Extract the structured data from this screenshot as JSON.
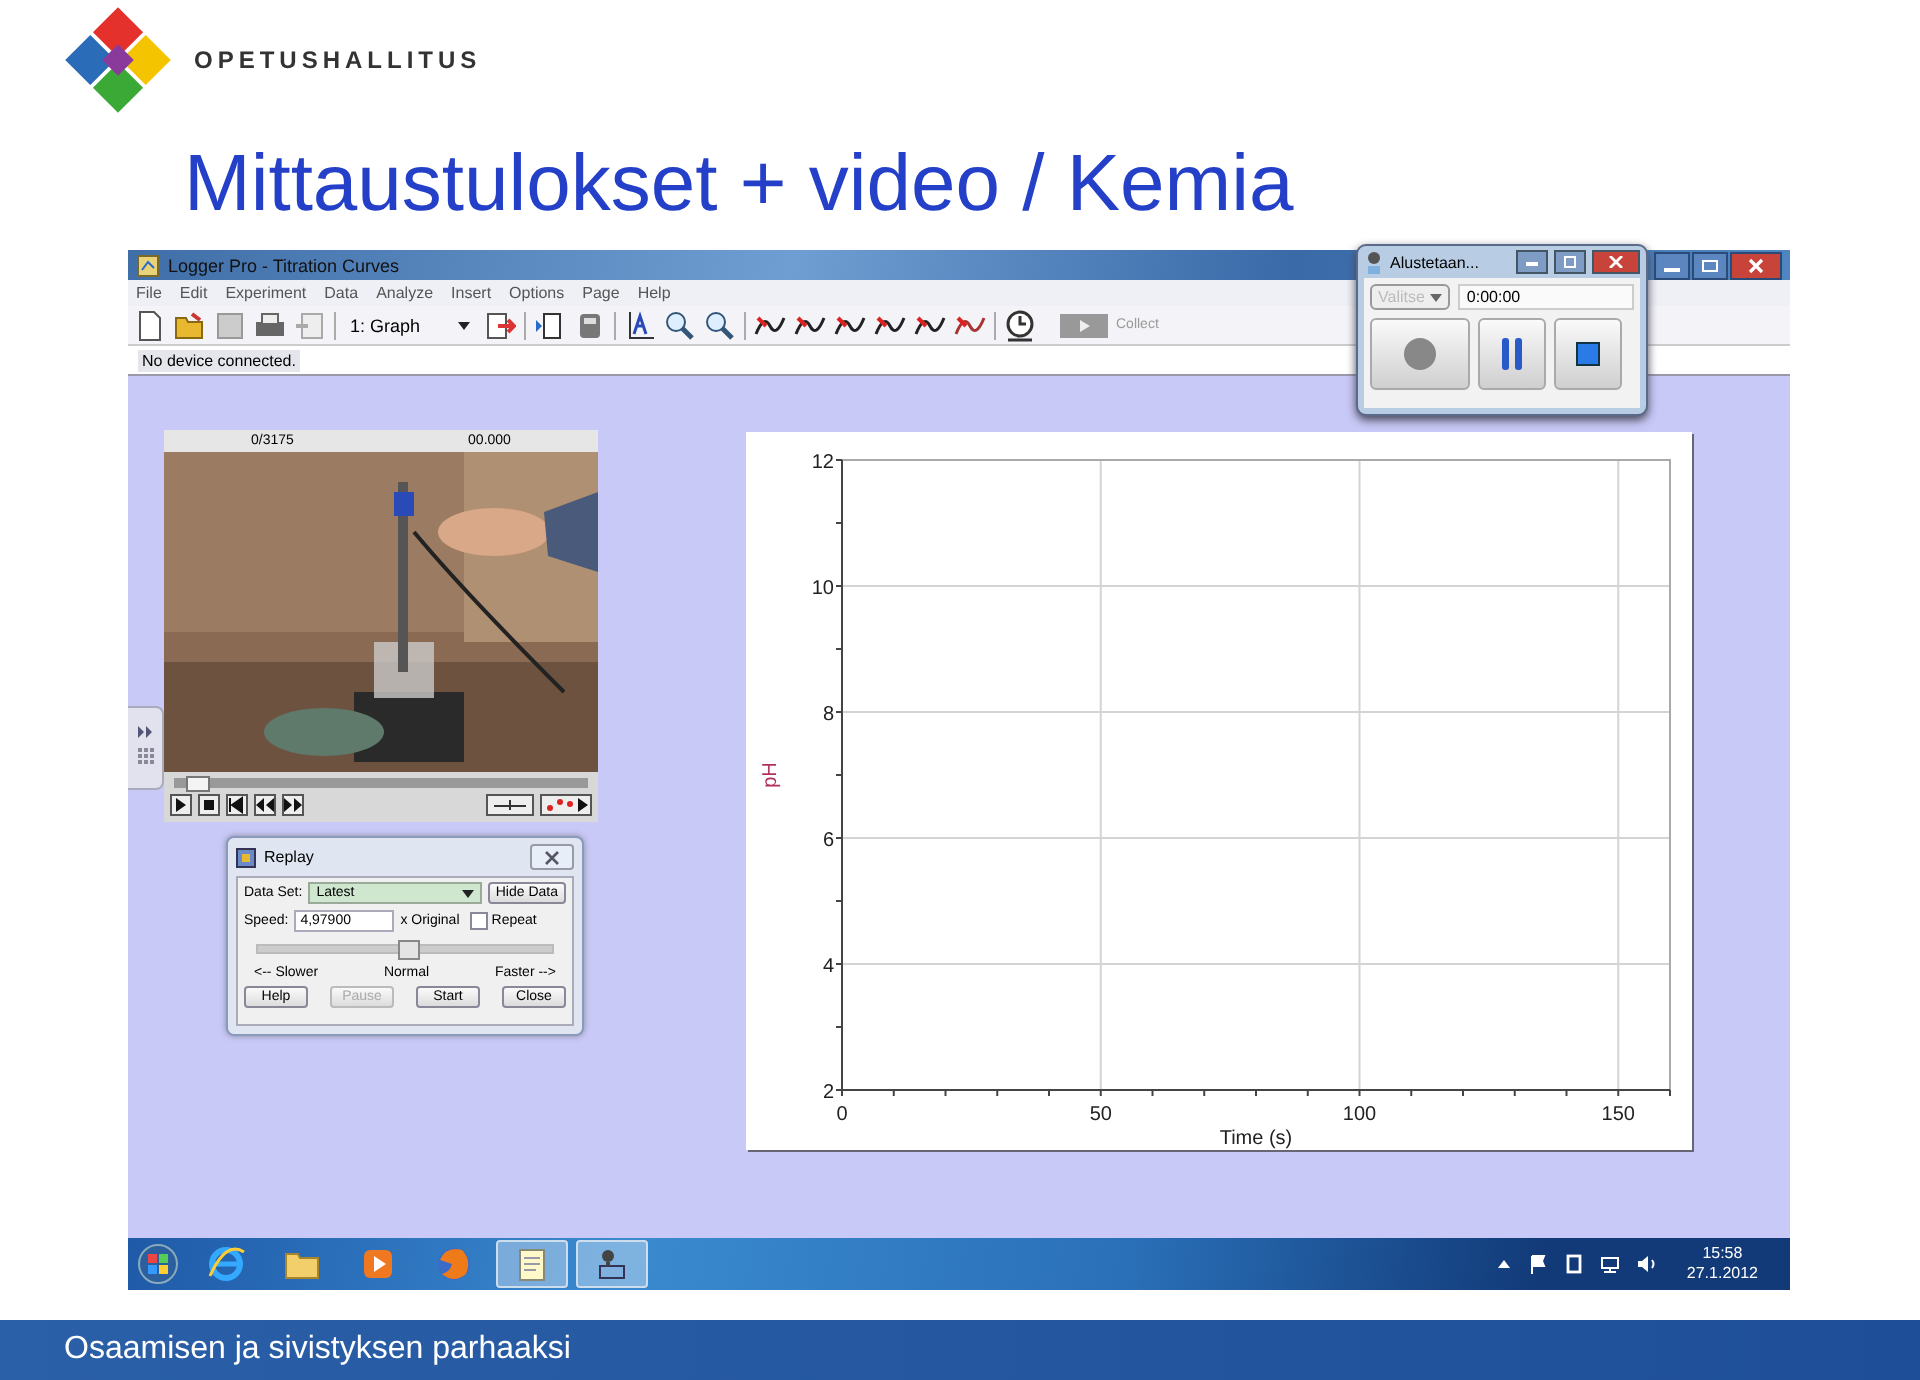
{
  "slide": {
    "logo_text": "OPETUSHALLITUS",
    "title": "Mittaustulokset + video / Kemia",
    "footer": "Osaamisen ja sivistyksen parhaaksi"
  },
  "app": {
    "title": "Logger Pro - Titration Curves",
    "menu": [
      "File",
      "Edit",
      "Experiment",
      "Data",
      "Analyze",
      "Insert",
      "Options",
      "Page",
      "Help"
    ],
    "page_select": "1: Graph",
    "collect": "Collect",
    "status": "No device connected."
  },
  "recorder": {
    "title": "Alustetaan...",
    "select": "Valitse",
    "select_disabled": true,
    "time": "0:00:00"
  },
  "video": {
    "frame": "0/3175",
    "time": "00.000",
    "level": 0.03
  },
  "replay": {
    "title": "Replay",
    "data_set_label": "Data Set:",
    "data_set": "Latest",
    "hide_data": "Hide Data",
    "speed_label": "Speed:",
    "speed": "4,97900",
    "speed_unit": "x Original",
    "repeat": {
      "label": "Repeat",
      "checked": false
    },
    "level": 0.5,
    "slower": "<-- Slower",
    "normal": "Normal",
    "faster": "Faster -->",
    "buttons": [
      {
        "label": "Help",
        "disabled": false
      },
      {
        "label": "Pause",
        "disabled": true
      },
      {
        "label": "Start",
        "disabled": false
      },
      {
        "label": "Close",
        "disabled": false
      }
    ]
  },
  "graph": {
    "chart_data": {
      "type": "line",
      "grid": true,
      "xlabel": "Time (s)",
      "ylabel": "pH",
      "xlim": [
        0,
        160
      ],
      "ylim": [
        2,
        12
      ],
      "xticks": [
        0,
        50,
        100,
        150
      ],
      "yticks": [
        2,
        4,
        6,
        8,
        10,
        12
      ]
    }
  },
  "taskbar": {
    "apps": [
      {
        "kind": "start",
        "selected": false
      },
      {
        "kind": "browser",
        "selected": false
      },
      {
        "kind": "folder",
        "selected": false
      },
      {
        "kind": "media",
        "selected": false
      },
      {
        "kind": "firefox",
        "selected": false
      },
      {
        "kind": "notepad",
        "selected": true
      },
      {
        "kind": "recorder",
        "selected": true
      }
    ],
    "time": "15:58",
    "date": "27.1.2012"
  }
}
